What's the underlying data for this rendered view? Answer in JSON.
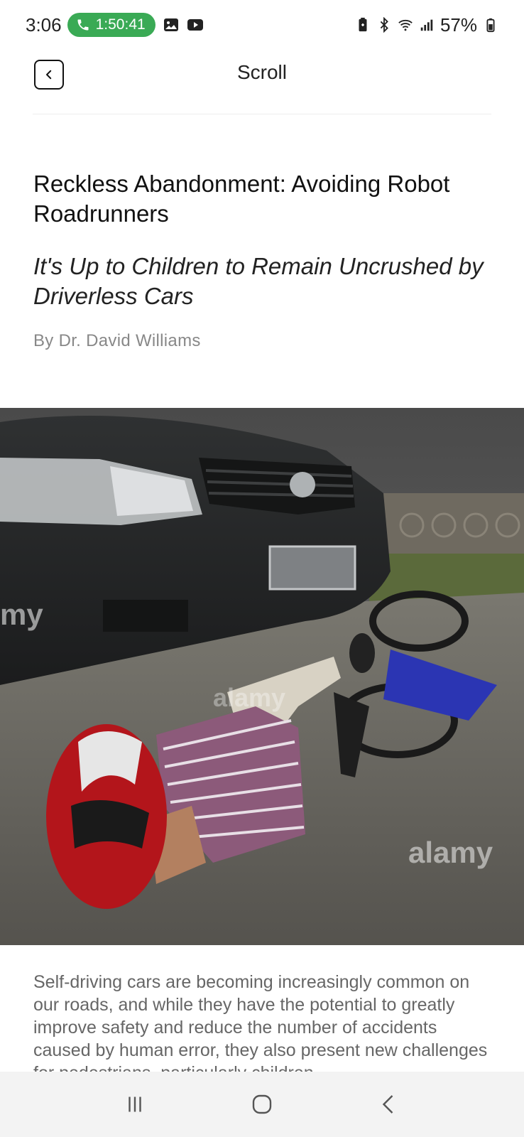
{
  "status_bar": {
    "time": "3:06",
    "call_timer": "1:50:41",
    "battery": "57%",
    "icons": [
      "phone-icon",
      "gallery-icon",
      "youtube-icon",
      "battery-saver-icon",
      "bluetooth-icon",
      "wifi-icon",
      "signal-icon",
      "battery-icon"
    ],
    "call_color": "#3aaa55"
  },
  "header": {
    "title": "Scroll",
    "back_icon": "chevron-left-icon"
  },
  "article": {
    "title": "Reckless Abandonment: Avoiding Robot Roadrunners",
    "subtitle": "It's Up to Children to Remain Uncrushed by Driverless Cars",
    "byline": "By Dr. David Williams",
    "body": "Self-driving cars are becoming increasingly common on our roads, and while they have the potential to greatly improve safety and reduce the number of accidents caused by human error, they also present new challenges for pedestrians, particularly children"
  },
  "hero_image": {
    "watermark": "alamy"
  },
  "nav_bar": {
    "icons": [
      "recent-apps-icon",
      "home-icon",
      "back-icon"
    ]
  }
}
